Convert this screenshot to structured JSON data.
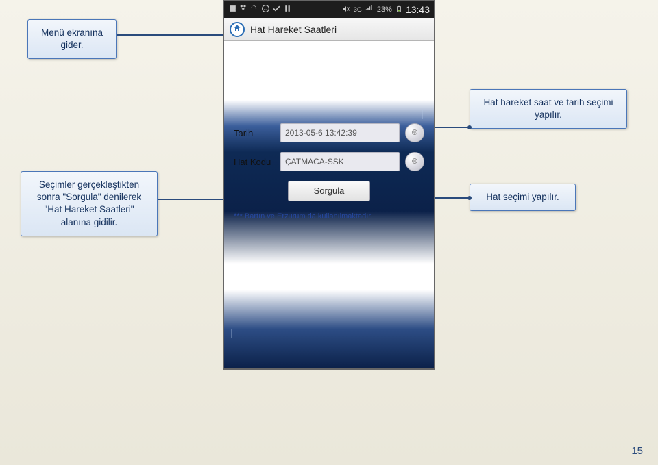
{
  "page_number": "15",
  "statusbar": {
    "battery": "23%",
    "time": "13:43"
  },
  "header": {
    "title": "Hat Hareket Saatleri"
  },
  "form": {
    "tarih_label": "Tarih",
    "tarih_value": "2013-05-6 13:42:39",
    "hatkodu_label": "Hat Kodu",
    "hatkodu_value": "ÇATMACA-SSK",
    "sorgula": "Sorgula",
    "note": "*** Bartın ve Erzurum da kullanılmaktadır."
  },
  "callouts": {
    "c1": "Menü ekranına gider.",
    "c2": "Hat hareket saat ve tarih seçimi yapılır.",
    "c3": "Seçimler gerçekleştikten sonra \"Sorgula\" denilerek \"Hat Hareket Saatleri\" alanına gidilir.",
    "c4": "Hat seçimi yapılır."
  }
}
